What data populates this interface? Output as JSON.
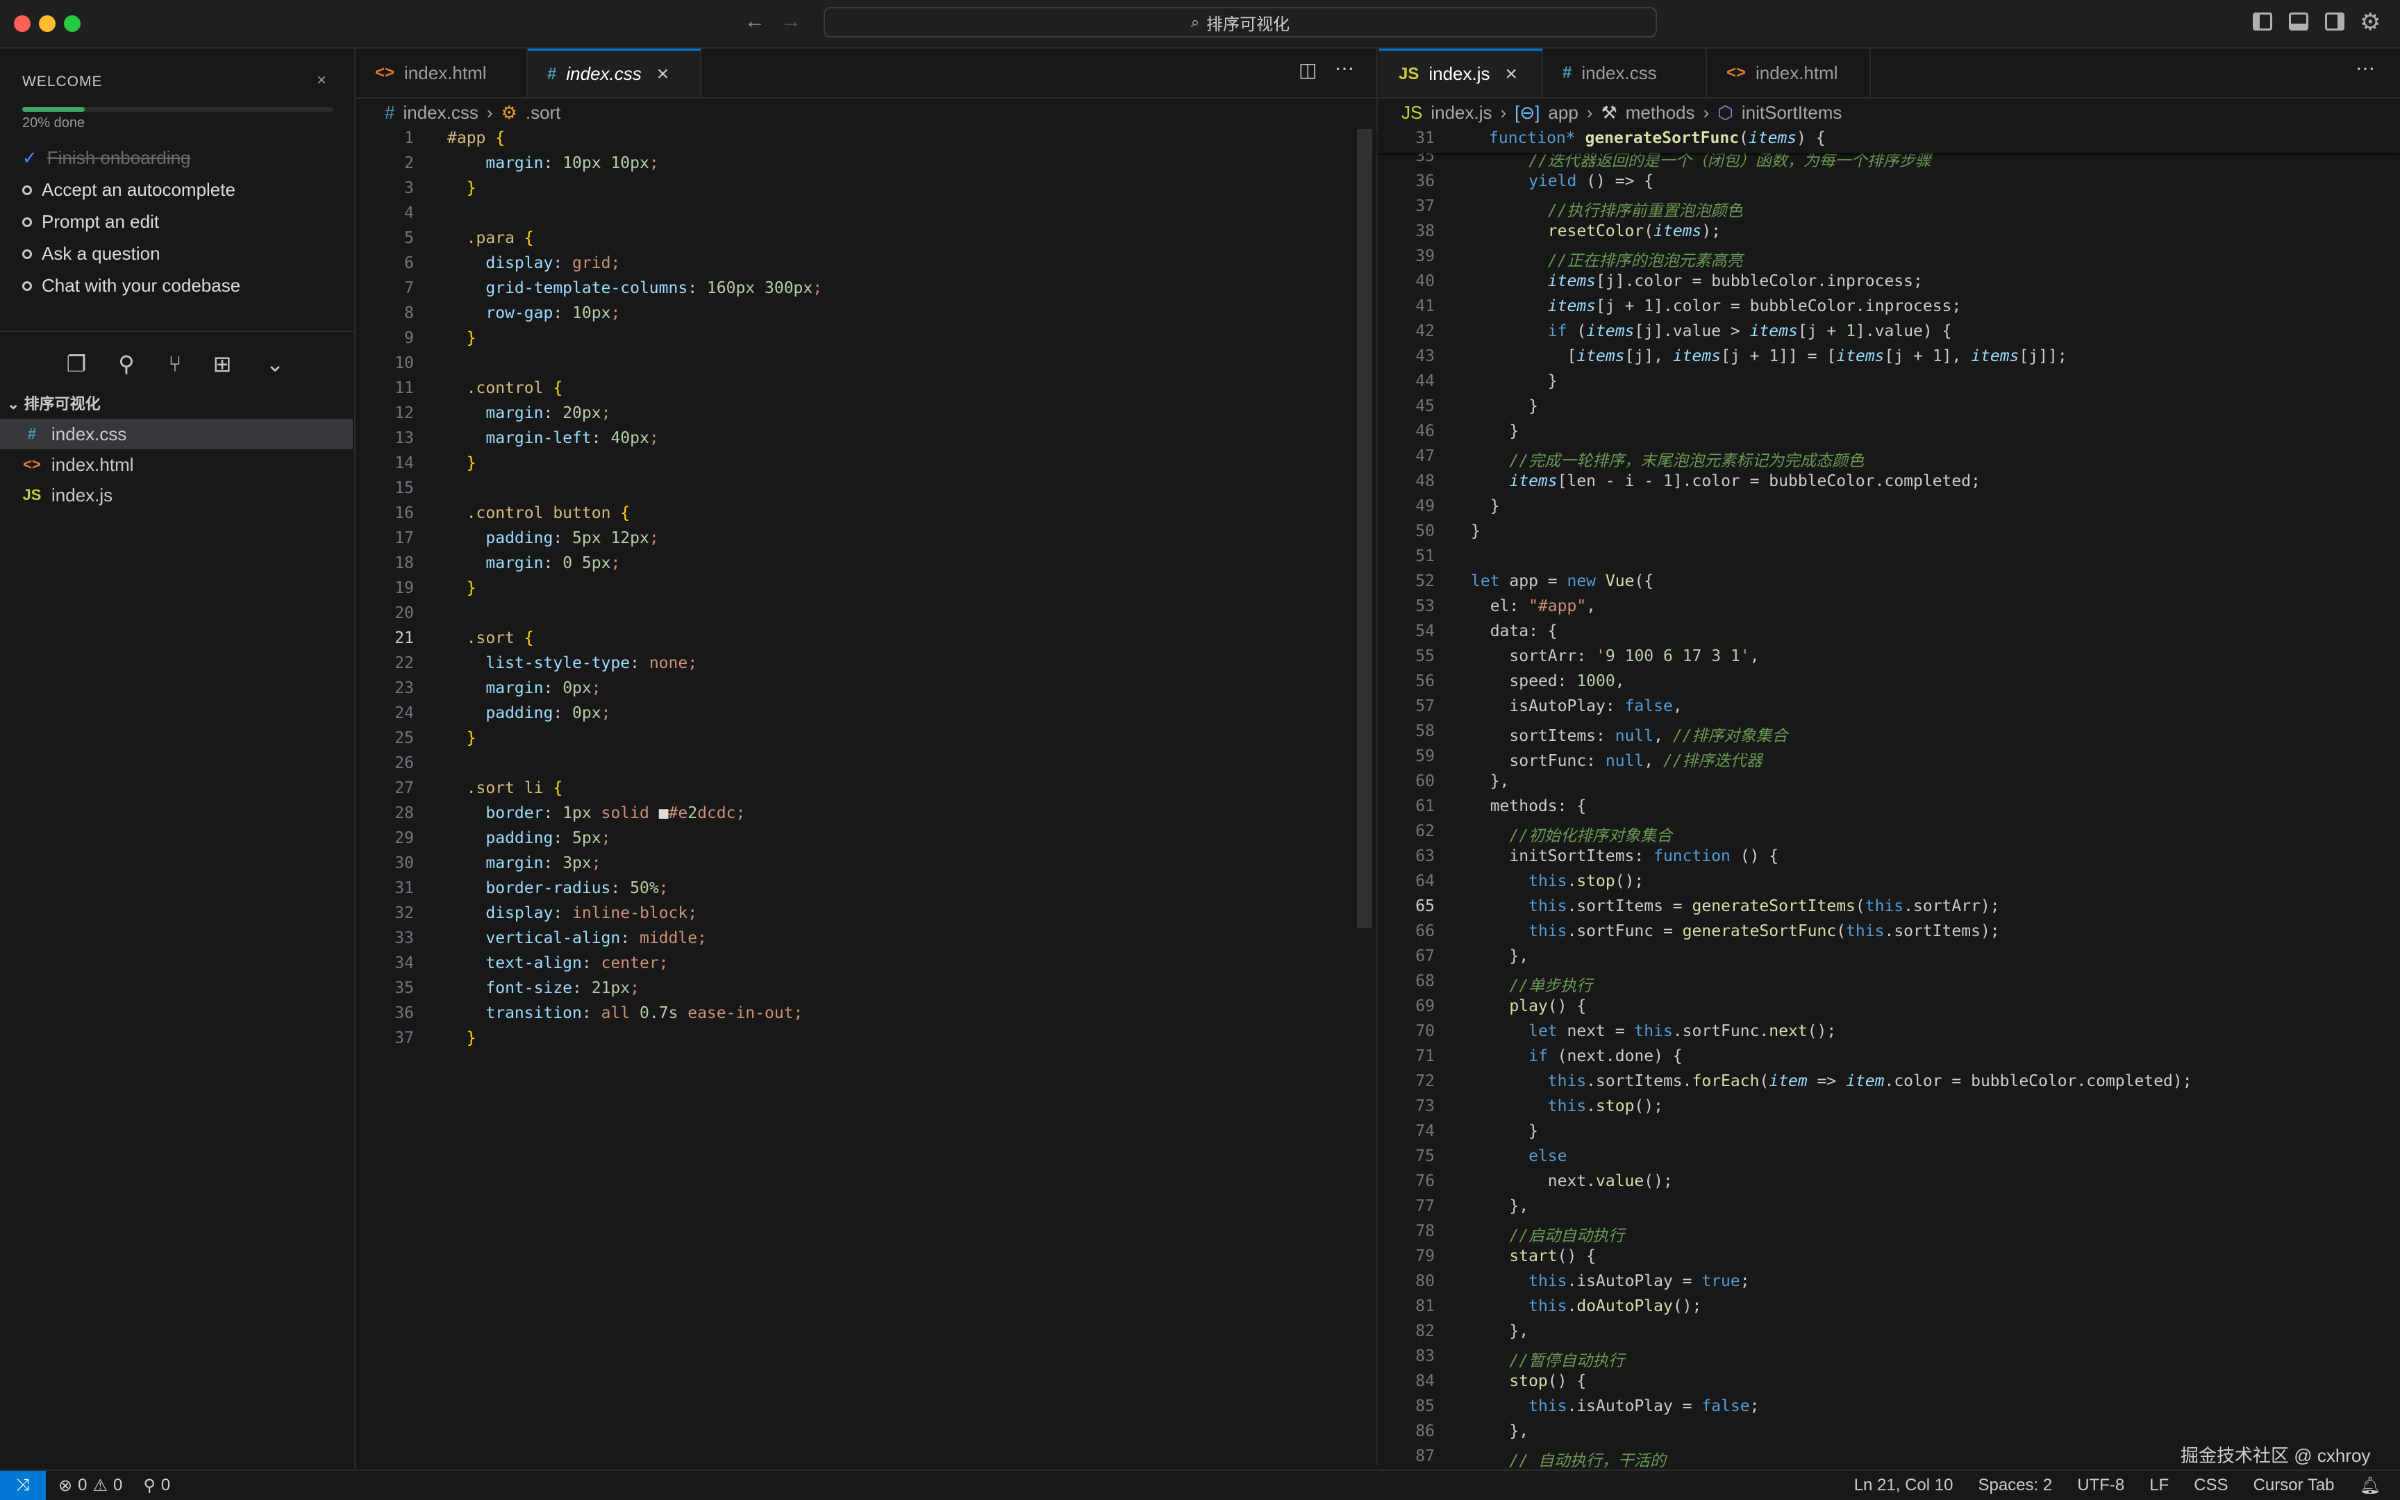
{
  "titlebar": {
    "search_text": "排序可视化"
  },
  "welcome": {
    "title": "WELCOME",
    "progress_percent": 20,
    "progress_text": "20% done",
    "items": [
      {
        "label": "Finish onboarding",
        "done": true
      },
      {
        "label": "Accept an autocomplete",
        "done": false
      },
      {
        "label": "Prompt an edit",
        "done": false
      },
      {
        "label": "Ask a question",
        "done": false
      },
      {
        "label": "Chat with your codebase",
        "done": false
      }
    ]
  },
  "explorer": {
    "folder": "排序可视化",
    "files": [
      {
        "name": "index.css",
        "icon": "#",
        "color": "#519aba",
        "active": true
      },
      {
        "name": "index.html",
        "icon": "<>",
        "color": "#e37933",
        "active": false
      },
      {
        "name": "index.js",
        "icon": "JS",
        "color": "#cbcb41",
        "active": false
      }
    ]
  },
  "editor1": {
    "tabs": [
      {
        "label": "index.html",
        "icon": "<>",
        "color": "#e37933",
        "active": false
      },
      {
        "label": "index.css",
        "icon": "#",
        "color": "#519aba",
        "active": true
      }
    ],
    "breadcrumb": [
      "index.css",
      ".sort"
    ],
    "first_line": 1,
    "current_line": 21,
    "lines": [
      "#app {",
      "    margin: 10px 10px;",
      "  }",
      "",
      "  .para {",
      "    display: grid;",
      "    grid-template-columns: 160px 300px;",
      "    row-gap: 10px;",
      "  }",
      "",
      "  .control {",
      "    margin: 20px;",
      "    margin-left: 40px;",
      "  }",
      "",
      "  .control button {",
      "    padding: 5px 12px;",
      "    margin: 0 5px;",
      "  }",
      "",
      "  .sort {",
      "    list-style-type: none;",
      "    margin: 0px;",
      "    padding: 0px;",
      "  }",
      "",
      "  .sort li {",
      "    border: 1px solid ■#e2dcdc;",
      "    padding: 5px;",
      "    margin: 3px;",
      "    border-radius: 50%;",
      "    display: inline-block;",
      "    vertical-align: middle;",
      "    text-align: center;",
      "    font-size: 21px;",
      "    transition: all 0.7s ease-in-out;",
      "  }"
    ]
  },
  "editor2": {
    "tabs": [
      {
        "label": "index.js",
        "icon": "JS",
        "color": "#cbcb41",
        "active": true
      },
      {
        "label": "index.css",
        "icon": "#",
        "color": "#519aba",
        "active": false
      },
      {
        "label": "index.html",
        "icon": "<>",
        "color": "#e37933",
        "active": false
      }
    ],
    "breadcrumb": [
      "index.js",
      "app",
      "methods",
      "initSortItems"
    ],
    "sticky_line": {
      "num": 31,
      "text": "function* generateSortFunc(items) {"
    },
    "first_line": 35,
    "current_line": 65,
    "lines": [
      "      //迭代器返回的是一个（闭包）函数，为每一个排序步骤",
      "      yield () => {",
      "        //执行排序前重置泡泡颜色",
      "        resetColor(items);",
      "        //正在排序的泡泡元素高亮",
      "        items[j].color = bubbleColor.inprocess;",
      "        items[j + 1].color = bubbleColor.inprocess;",
      "        if (items[j].value > items[j + 1].value) {",
      "          [items[j], items[j + 1]] = [items[j + 1], items[j]];",
      "        }",
      "      }",
      "    }",
      "    //完成一轮排序，末尾泡泡元素标记为完成态颜色",
      "    items[len - i - 1].color = bubbleColor.completed;",
      "  }",
      "}",
      "",
      "let app = new Vue({",
      "  el: \"#app\",",
      "  data: {",
      "    sortArr: '9 100 6 17 3 1',",
      "    speed: 1000,",
      "    isAutoPlay: false,",
      "    sortItems: null, //排序对象集合",
      "    sortFunc: null, //排序迭代器",
      "  },",
      "  methods: {",
      "    //初始化排序对象集合",
      "    initSortItems: function () {",
      "      this.stop();",
      "      this.sortItems = generateSortItems(this.sortArr);",
      "      this.sortFunc = generateSortFunc(this.sortItems);",
      "    },",
      "    //单步执行",
      "    play() {",
      "      let next = this.sortFunc.next();",
      "      if (next.done) {",
      "        this.sortItems.forEach(item => item.color = bubbleColor.completed);",
      "        this.stop();",
      "      }",
      "      else",
      "        next.value();",
      "    },",
      "    //启动自动执行",
      "    start() {",
      "      this.isAutoPlay = true;",
      "      this.doAutoPlay();",
      "    },",
      "    //暂停自动执行",
      "    stop() {",
      "      this.isAutoPlay = false;",
      "    },",
      "    // 自动执行，干活的"
    ]
  },
  "statusbar": {
    "errors": "0",
    "warnings": "0",
    "ports": "0",
    "position": "Ln 21, Col 10",
    "spaces": "Spaces: 2",
    "encoding": "UTF-8",
    "eol": "LF",
    "language": "CSS",
    "tab_mode": "Cursor Tab"
  },
  "watermark": "掘金技术社区 @ cxhroy"
}
